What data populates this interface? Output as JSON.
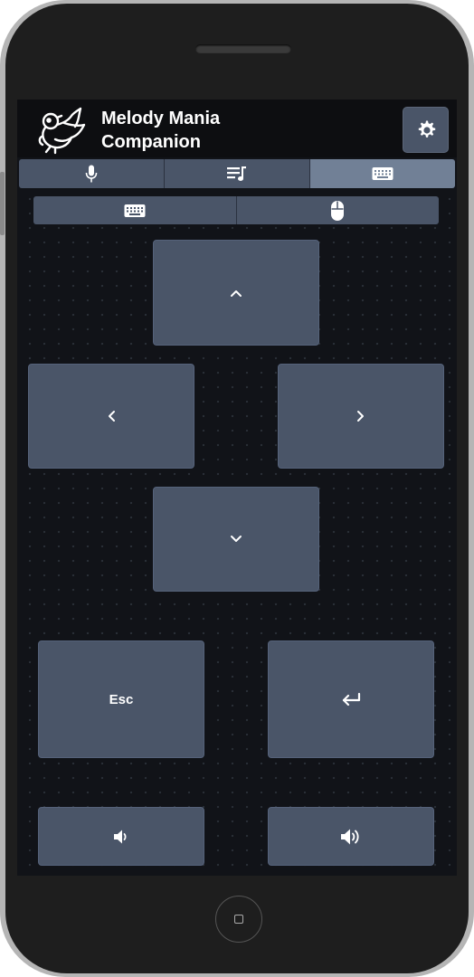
{
  "app": {
    "title_line1": "Melody Mania",
    "title_line2": "Companion",
    "logo_icon": "angel-bird-logo-icon"
  },
  "header": {
    "settings_icon": "gear-icon"
  },
  "tabs": [
    {
      "icon": "microphone-icon",
      "active": false
    },
    {
      "icon": "playlist-icon",
      "active": false
    },
    {
      "icon": "keyboard-icon",
      "active": true
    }
  ],
  "subtabs": [
    {
      "icon": "keyboard-icon"
    },
    {
      "icon": "mouse-icon"
    }
  ],
  "keys": {
    "up_icon": "chevron-up-icon",
    "left_icon": "chevron-left-icon",
    "right_icon": "chevron-right-icon",
    "down_icon": "chevron-down-icon",
    "esc_label": "Esc",
    "enter_icon": "enter-arrow-icon",
    "volume_down_icon": "volume-down-icon",
    "volume_up_icon": "volume-up-icon"
  },
  "colors": {
    "accent": "#4a5568",
    "active_tab": "#718096",
    "background": "#111318"
  }
}
